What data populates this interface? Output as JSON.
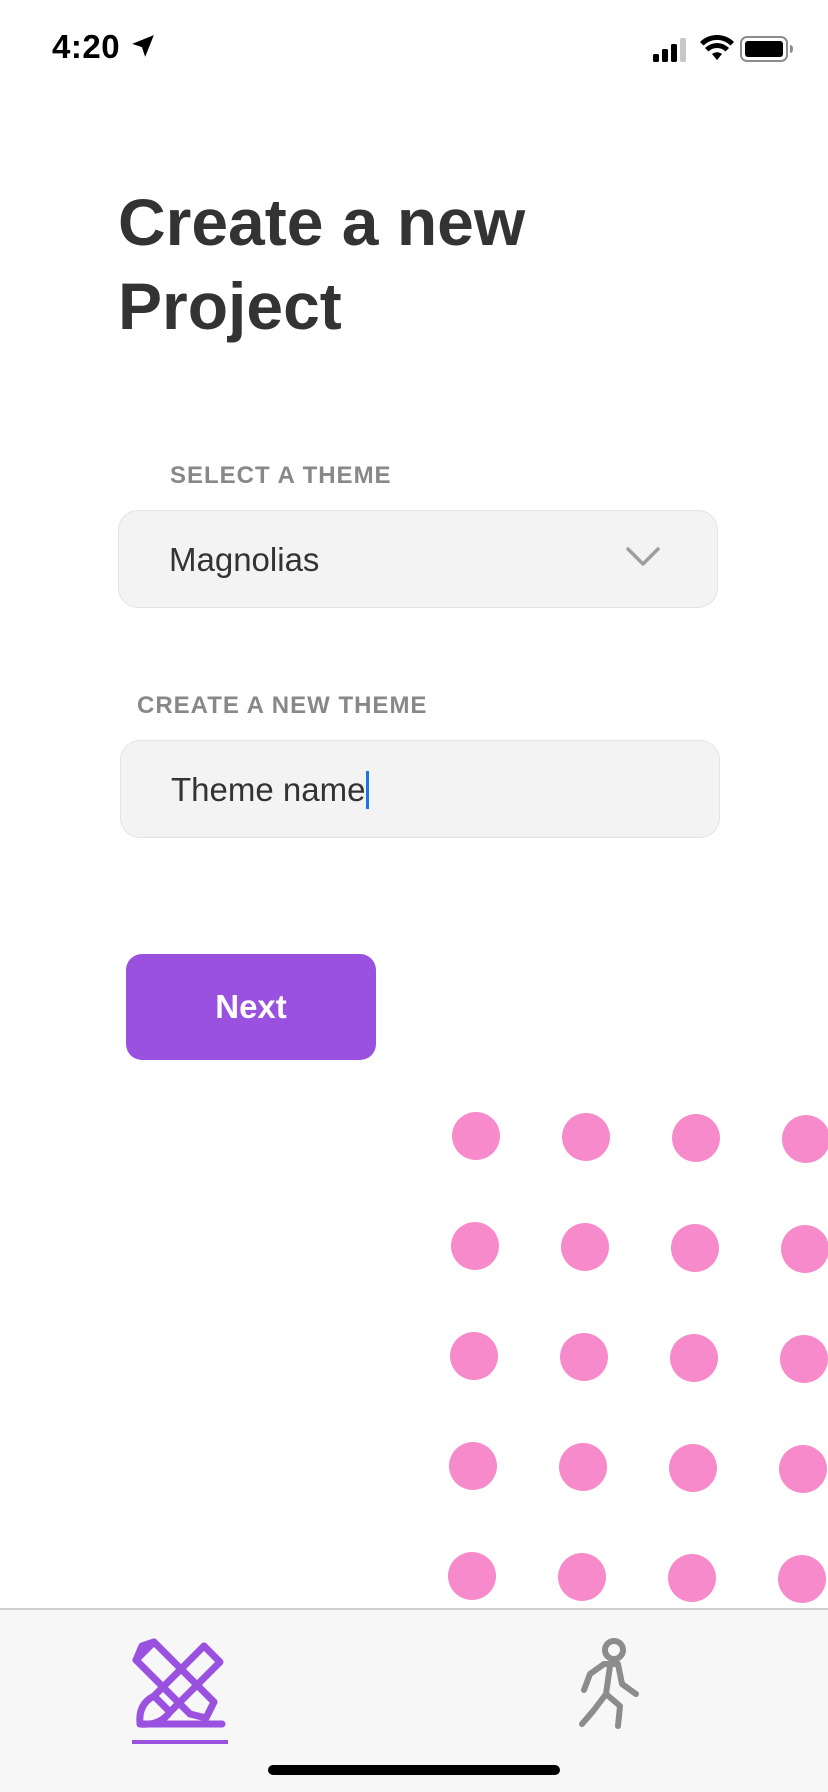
{
  "status_bar": {
    "time": "4:20",
    "icons": [
      "location-arrow-icon",
      "cellular-signal-icon",
      "wifi-icon",
      "battery-icon"
    ]
  },
  "page": {
    "title": "Create a new Project"
  },
  "form": {
    "select_theme": {
      "label": "SELECT A THEME",
      "value": "Magnolias",
      "icon": "chevron-down-icon"
    },
    "new_theme": {
      "label": "CREATE A NEW THEME",
      "value": "Theme name"
    },
    "next_label": "Next"
  },
  "tab_bar": {
    "tabs": [
      {
        "icon": "pencil-brush-icon",
        "active": true
      },
      {
        "icon": "person-walking-icon",
        "active": false
      }
    ]
  },
  "colors": {
    "accent": "#9b51e0",
    "dots": "#f68acb",
    "caret": "#1a73e8",
    "title": "#333333",
    "label": "#888888"
  }
}
